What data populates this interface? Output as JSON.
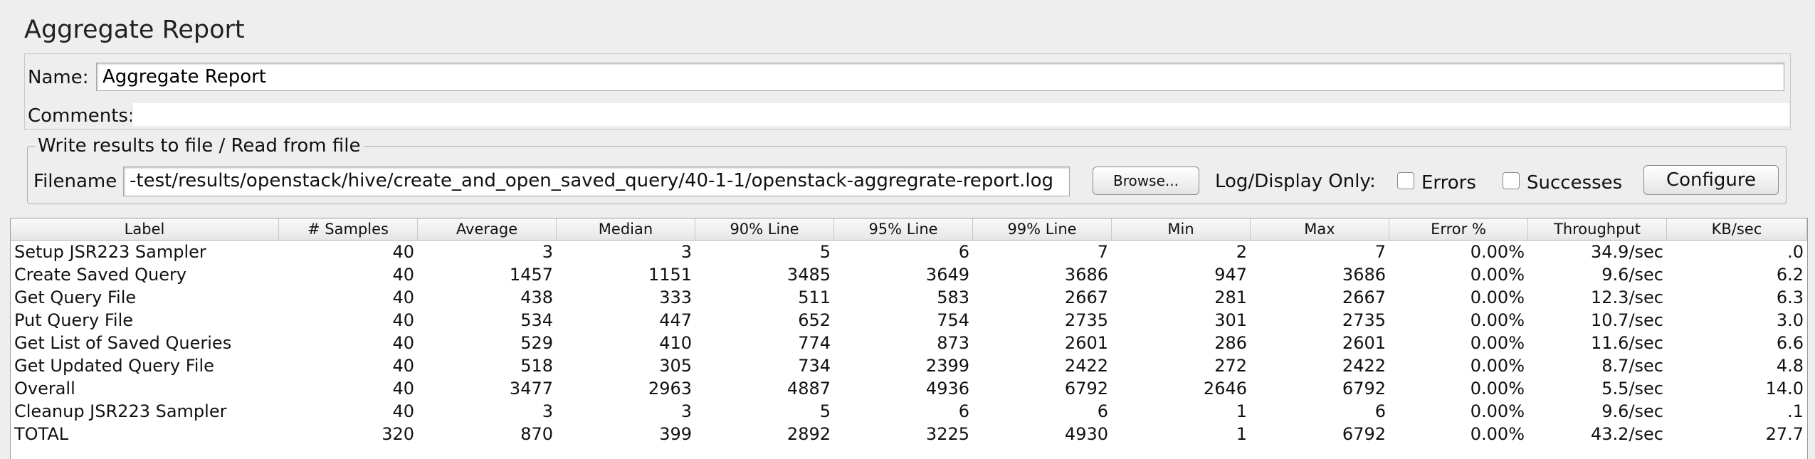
{
  "window": {
    "title": "Aggregate Report"
  },
  "form": {
    "name_label": "Name:",
    "name_value": "Aggregate Report",
    "comments_label": "Comments:"
  },
  "file_panel": {
    "legend": "Write results to file / Read from file",
    "filename_label": "Filename",
    "filename_value": "-test/results/openstack/hive/create_and_open_saved_query/40-1-1/openstack-aggregrate-report.log",
    "browse_label": "Browse...",
    "log_display_label": "Log/Display Only:",
    "errors_label": "Errors",
    "successes_label": "Successes",
    "configure_label": "Configure",
    "errors_checked": false,
    "successes_checked": false
  },
  "table": {
    "headers": [
      "Label",
      "# Samples",
      "Average",
      "Median",
      "90% Line",
      "95% Line",
      "99% Line",
      "Min",
      "Max",
      "Error %",
      "Throughput",
      "KB/sec"
    ],
    "rows": [
      [
        "Setup JSR223 Sampler",
        "40",
        "3",
        "3",
        "5",
        "6",
        "7",
        "2",
        "7",
        "0.00%",
        "34.9/sec",
        ".0"
      ],
      [
        "Create Saved Query",
        "40",
        "1457",
        "1151",
        "3485",
        "3649",
        "3686",
        "947",
        "3686",
        "0.00%",
        "9.6/sec",
        "6.2"
      ],
      [
        "Get Query File",
        "40",
        "438",
        "333",
        "511",
        "583",
        "2667",
        "281",
        "2667",
        "0.00%",
        "12.3/sec",
        "6.3"
      ],
      [
        "Put Query File",
        "40",
        "534",
        "447",
        "652",
        "754",
        "2735",
        "301",
        "2735",
        "0.00%",
        "10.7/sec",
        "3.0"
      ],
      [
        "Get List of Saved Queries",
        "40",
        "529",
        "410",
        "774",
        "873",
        "2601",
        "286",
        "2601",
        "0.00%",
        "11.6/sec",
        "6.6"
      ],
      [
        "Get Updated Query File",
        "40",
        "518",
        "305",
        "734",
        "2399",
        "2422",
        "272",
        "2422",
        "0.00%",
        "8.7/sec",
        "4.8"
      ],
      [
        "Overall",
        "40",
        "3477",
        "2963",
        "4887",
        "4936",
        "6792",
        "2646",
        "6792",
        "0.00%",
        "5.5/sec",
        "14.0"
      ],
      [
        "Cleanup JSR223 Sampler",
        "40",
        "3",
        "3",
        "5",
        "6",
        "6",
        "1",
        "6",
        "0.00%",
        "9.6/sec",
        ".1"
      ],
      [
        "TOTAL",
        "320",
        "870",
        "399",
        "2892",
        "3225",
        "4930",
        "1",
        "6792",
        "0.00%",
        "43.2/sec",
        "27.7"
      ]
    ]
  }
}
